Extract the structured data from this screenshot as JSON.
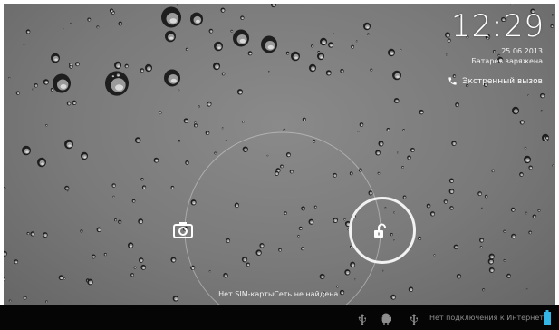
{
  "lockscreen": {
    "time": "12:29",
    "date": "25.06.2013",
    "battery_status": "Батарея заряжена",
    "emergency_call_label": "Экстренный вызов",
    "carrier_text": "Нет SIM-картыСеть не найдена."
  },
  "statusbar": {
    "network_text": "Нет подключения к Интернету",
    "icons": [
      "usb-icon",
      "android-debug-icon",
      "usb-icon",
      "battery-icon"
    ]
  },
  "icons": {
    "camera": "camera-icon",
    "unlock": "unlocked-padlock-icon",
    "phone": "phone-icon"
  },
  "colors": {
    "accent_battery": "#33b5e5",
    "navbar": "#050505"
  }
}
